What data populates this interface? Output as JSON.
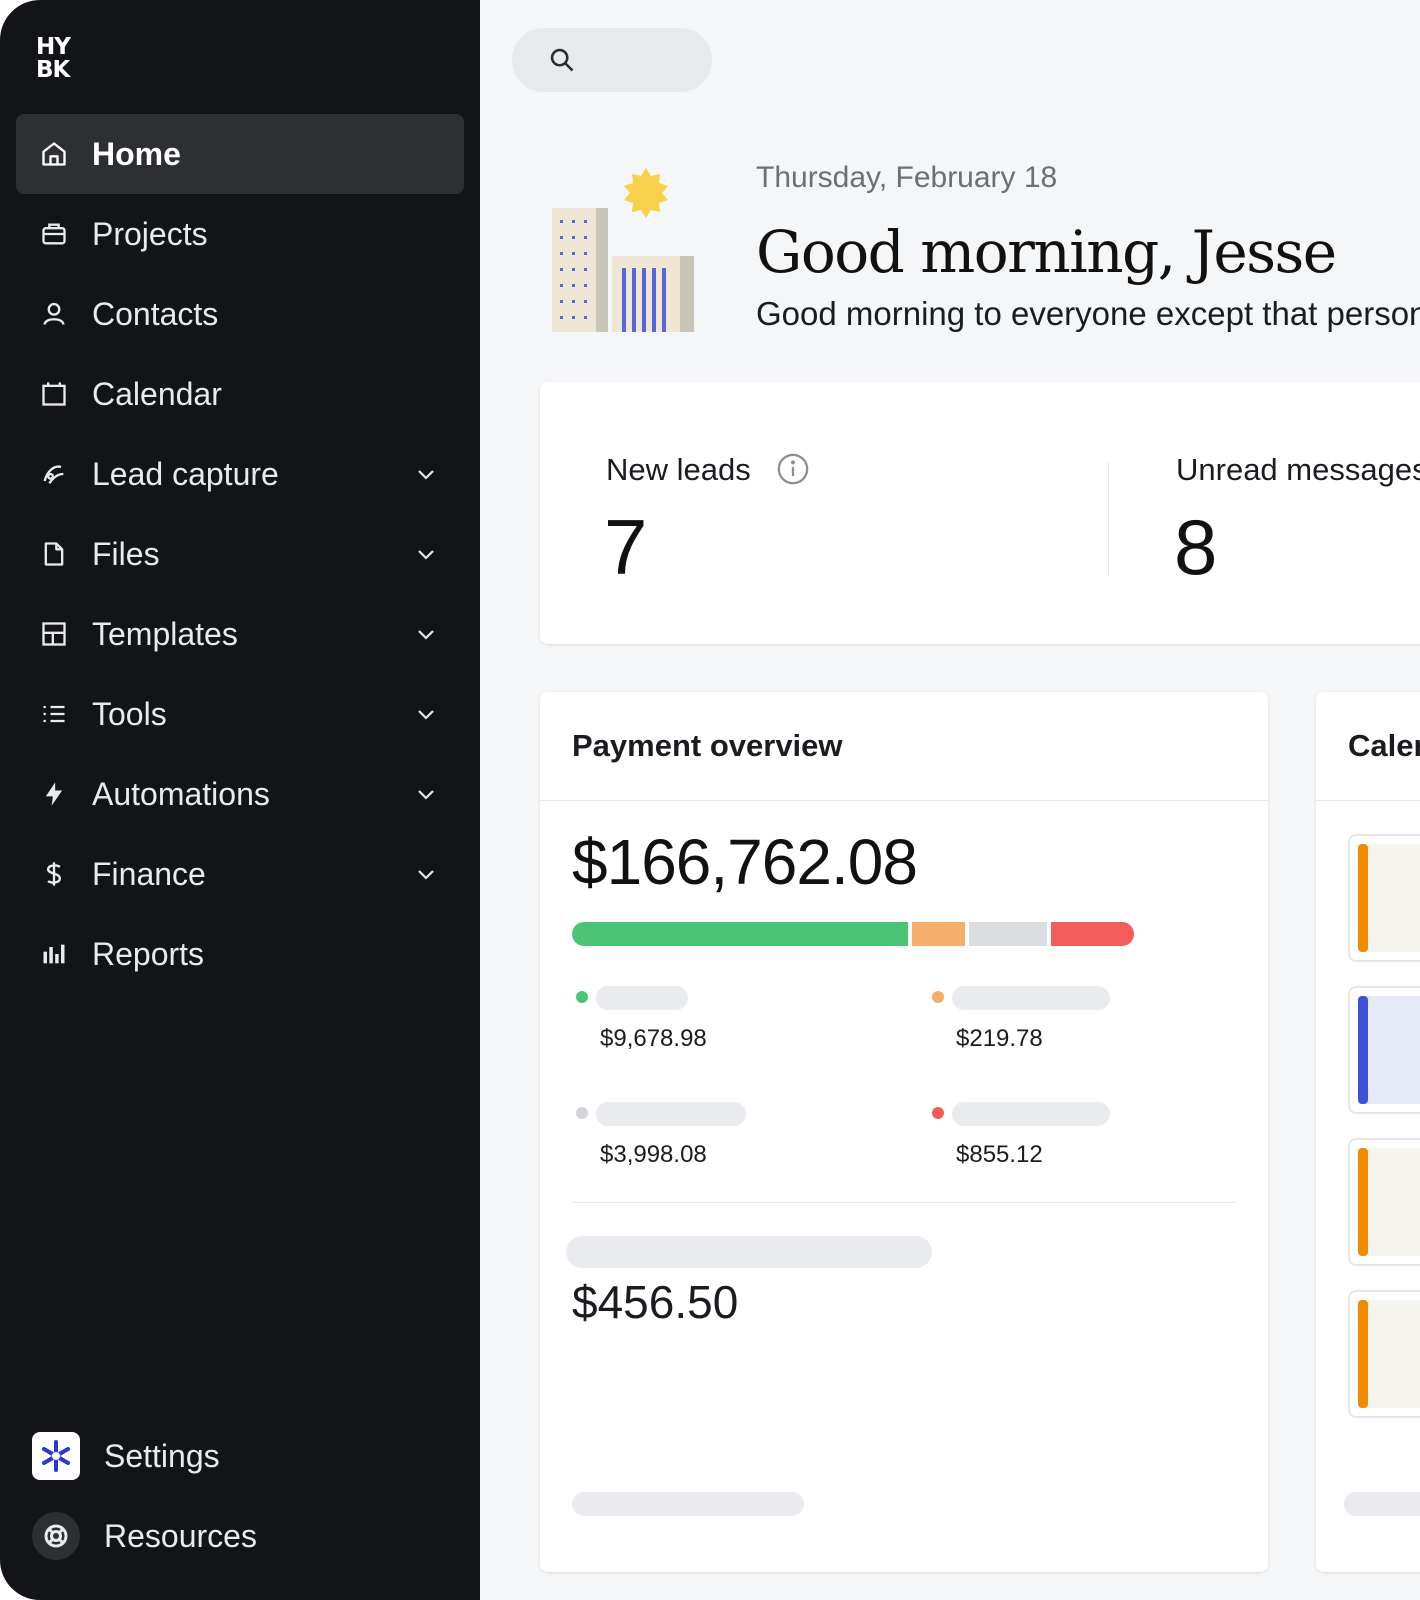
{
  "brand": {
    "logo_line1": "HY",
    "logo_line2": "BK"
  },
  "sidebar": {
    "items": [
      {
        "label": "Home",
        "icon": "home-icon",
        "active": true
      },
      {
        "label": "Projects",
        "icon": "briefcase-icon"
      },
      {
        "label": "Contacts",
        "icon": "person-icon"
      },
      {
        "label": "Calendar",
        "icon": "calendar-icon"
      },
      {
        "label": "Lead capture",
        "icon": "lead-capture-icon",
        "expandable": true
      },
      {
        "label": "Files",
        "icon": "file-icon",
        "expandable": true
      },
      {
        "label": "Templates",
        "icon": "template-icon",
        "expandable": true
      },
      {
        "label": "Tools",
        "icon": "list-icon",
        "expandable": true
      },
      {
        "label": "Automations",
        "icon": "lightning-icon",
        "expandable": true
      },
      {
        "label": "Finance",
        "icon": "dollar-icon",
        "expandable": true
      },
      {
        "label": "Reports",
        "icon": "bar-chart-icon"
      }
    ],
    "settings_label": "Settings",
    "resources_label": "Resources"
  },
  "greeting": {
    "date": "Thursday, February 18",
    "title": "Good morning, Jesse",
    "subtitle": "Good morning to everyone except that person who cut me off"
  },
  "stats": {
    "new_leads_label": "New leads",
    "new_leads_value": "7",
    "unread_label": "Unread messages",
    "unread_value": "8"
  },
  "payment": {
    "title": "Payment overview",
    "total": "$166,762.08",
    "bar_shares": [
      0.605,
      0.096,
      0.14,
      0.149
    ],
    "colors": {
      "green": "#4cc476",
      "orange": "#f7ad6a",
      "gray": "#dcdde0",
      "red": "#f45b5b"
    },
    "legend": [
      {
        "value": "$9,678.98",
        "color": "#4cc476"
      },
      {
        "value": "$219.78",
        "color": "#f7ad6a"
      },
      {
        "value": "$3,998.08",
        "color": "#d2d4d8"
      },
      {
        "value": "$855.12",
        "color": "#f45b5b"
      }
    ],
    "secondary_amount": "$456.50"
  },
  "calendar": {
    "title": "Calendar",
    "items": [
      {
        "stripe": "#f08c00",
        "bg": "#f6f4ef"
      },
      {
        "stripe": "#3d52d5",
        "bg": "#e6e9f6"
      },
      {
        "stripe": "#f08c00",
        "bg": "#f6f4ef"
      },
      {
        "stripe": "#f08c00",
        "bg": "#f6f4ef"
      }
    ]
  }
}
